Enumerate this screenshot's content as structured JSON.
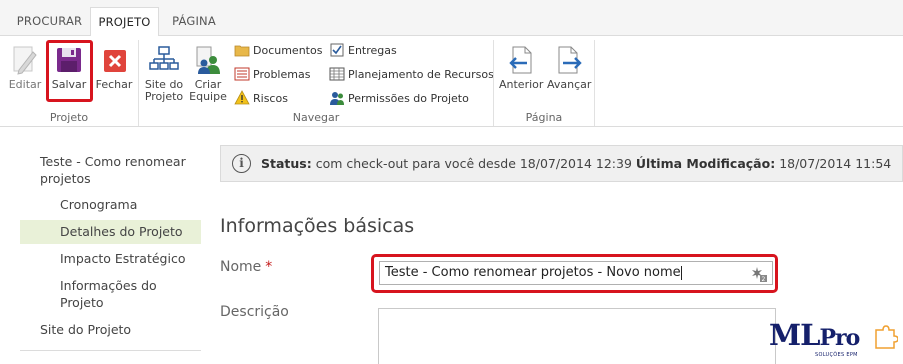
{
  "tabs": [
    {
      "label": "PROCURAR",
      "active": false
    },
    {
      "label": "PROJETO",
      "active": true
    },
    {
      "label": "PÁGINA",
      "active": false
    }
  ],
  "ribbon": {
    "groups": {
      "projeto": "Projeto",
      "navegar": "Navegar",
      "pagina": "Página"
    },
    "buttons": {
      "editar": "Editar",
      "salvar": "Salvar",
      "fechar": "Fechar",
      "site_line1": "Site do",
      "site_line2": "Projeto",
      "criar_line1": "Criar",
      "criar_line2": "Equipe",
      "documentos": "Documentos",
      "problemas": "Problemas",
      "riscos": "Riscos",
      "entregas": "Entregas",
      "planejamento": "Planejamento de Recursos",
      "permissoes": "Permissões do Projeto",
      "anterior": "Anterior",
      "avancar": "Avançar"
    }
  },
  "nav": {
    "items": [
      {
        "label": "Teste - Como renomear projetos",
        "level": "top"
      },
      {
        "label": "Cronograma",
        "level": "sub"
      },
      {
        "label": "Detalhes do Projeto",
        "level": "sub",
        "selected": true
      },
      {
        "label": "Impacto Estratégico",
        "level": "sub"
      },
      {
        "label": "Informações do Projeto",
        "level": "sub"
      },
      {
        "label": "Site do Projeto",
        "level": "top"
      }
    ]
  },
  "status": {
    "label": "Status:",
    "text": "com check-out para você desde 18/07/2014 12:39",
    "modified_label": "Última Modificação:",
    "modified_value": "18/07/2014 11:54"
  },
  "form": {
    "section_title": "Informações básicas",
    "name_label": "Nome",
    "required_mark": "*",
    "name_value": "Teste - Como renomear projetos - Novo nome",
    "description_label": "Descrição",
    "description_value": ""
  },
  "logo": {
    "main": "ML",
    "pro": "Pro",
    "sub": "SOLUÇÕES EPM"
  },
  "colors": {
    "highlight": "#d7141e",
    "selected_nav": "#e9f1d8",
    "logo": "#15206b"
  }
}
